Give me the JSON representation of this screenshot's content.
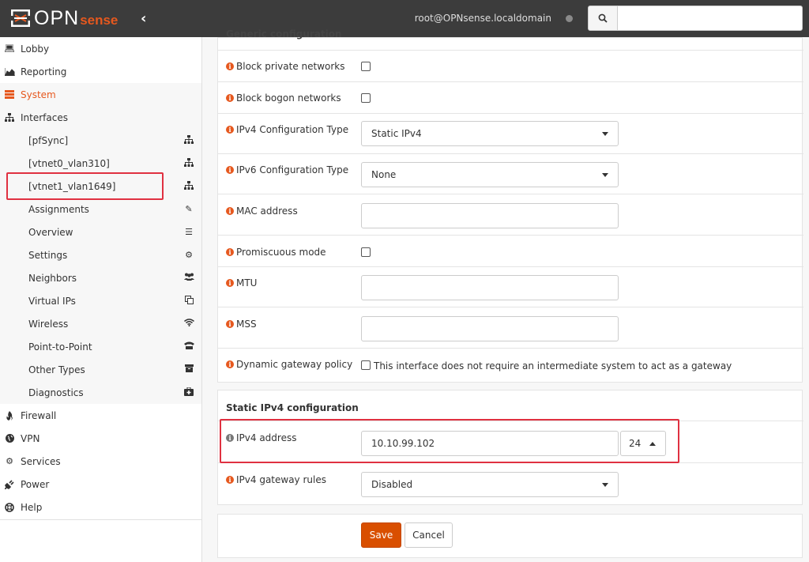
{
  "brand": {
    "opn": "OPN",
    "sense": "sense"
  },
  "header": {
    "user": "root@OPNsense.localdomain",
    "search_placeholder": ""
  },
  "sidebar": {
    "top_items": [
      {
        "label": "Lobby",
        "icon": "laptop-icon"
      },
      {
        "label": "Reporting",
        "icon": "area-chart-icon"
      },
      {
        "label": "System",
        "icon": "server-icon",
        "active": true
      },
      {
        "label": "Interfaces",
        "icon": "sitemap-icon"
      }
    ],
    "interface_sub": [
      {
        "label": "[pfSync]",
        "icon": "sitemap-icon"
      },
      {
        "label": "[vtnet0_vlan310]",
        "icon": "sitemap-icon"
      },
      {
        "label": "[vtnet1_vlan1649]",
        "icon": "sitemap-icon"
      },
      {
        "label": "Assignments",
        "icon": "pencil-icon"
      },
      {
        "label": "Overview",
        "icon": "tasks-icon"
      },
      {
        "label": "Settings",
        "icon": "cogs-icon"
      },
      {
        "label": "Neighbors",
        "icon": "users-icon"
      },
      {
        "label": "Virtual IPs",
        "icon": "clone-icon"
      },
      {
        "label": "Wireless",
        "icon": "wifi-icon"
      },
      {
        "label": "Point-to-Point",
        "icon": "tty-icon"
      },
      {
        "label": "Other Types",
        "icon": "archive-icon"
      },
      {
        "label": "Diagnostics",
        "icon": "medkit-icon"
      }
    ],
    "bottom_items": [
      {
        "label": "Firewall",
        "icon": "fire-icon"
      },
      {
        "label": "VPN",
        "icon": "globe-icon"
      },
      {
        "label": "Services",
        "icon": "cog-icon"
      },
      {
        "label": "Power",
        "icon": "plug-icon"
      },
      {
        "label": "Help",
        "icon": "life-ring-icon"
      }
    ]
  },
  "form": {
    "generic_title": "Generic configuration",
    "block_private": "Block private networks",
    "block_bogon": "Block bogon networks",
    "ipv4_type_label": "IPv4 Configuration Type",
    "ipv4_type_value": "Static IPv4",
    "ipv6_type_label": "IPv6 Configuration Type",
    "ipv6_type_value": "None",
    "mac_label": "MAC address",
    "promisc_label": "Promiscuous mode",
    "mtu_label": "MTU",
    "mss_label": "MSS",
    "dyn_gw_label": "Dynamic gateway policy",
    "dyn_gw_text": "This interface does not require an intermediate system to act as a gateway",
    "static_title": "Static IPv4 configuration",
    "ipv4_addr_label": "IPv4 address",
    "ipv4_addr_value": "10.10.99.102",
    "ipv4_cidr": "24",
    "ipv4_gw_label": "IPv4 gateway rules",
    "ipv4_gw_value": "Disabled"
  },
  "buttons": {
    "save": "Save",
    "cancel": "Cancel"
  },
  "colors": {
    "accent": "#e6581e",
    "topbar": "#3c3c3c",
    "highlight": "#e03141"
  }
}
